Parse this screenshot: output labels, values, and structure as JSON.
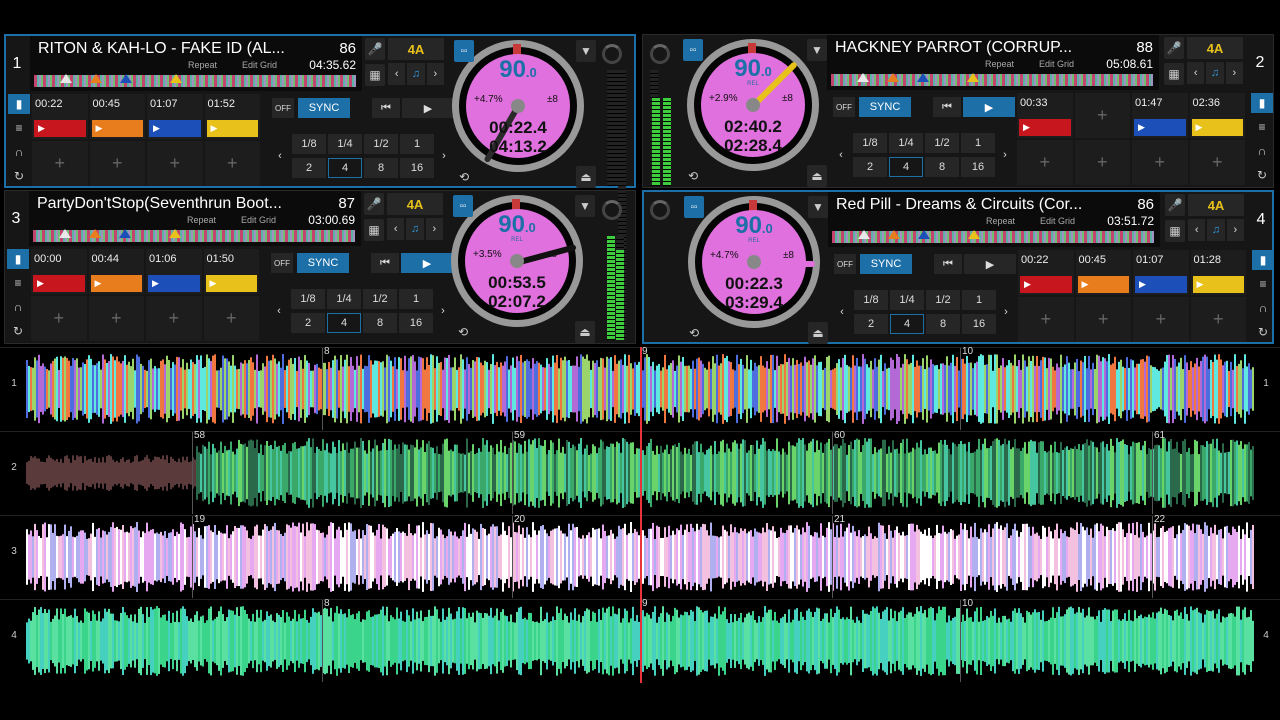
{
  "decks": [
    {
      "num": "1",
      "title": "RITON & KAH-LO - FAKE ID (AL...",
      "bpm": "86",
      "repeat": "Repeat",
      "edit_grid": "Edit Grid",
      "time": "04:35.62",
      "key": "4A",
      "jog": {
        "bpm_main": "90",
        "bpm_dec": ".0",
        "rel": "",
        "pitch": "+4.7%",
        "range": "±8",
        "elapsed": "00:22.4",
        "remaining": "04:13.2",
        "hand_angle": 120,
        "hand_color": "#2a2a2a"
      },
      "sync": "SYNC",
      "off": "OFF",
      "loops_top": [
        "1/8",
        "1/4",
        "1/2",
        "1"
      ],
      "loops_bottom": [
        "2",
        "4",
        "8",
        "16"
      ],
      "cues": [
        {
          "t": "00:22",
          "c": "#c8161e"
        },
        {
          "t": "00:45",
          "c": "#e87d1e"
        },
        {
          "t": "01:07",
          "c": "#1d4fb8"
        },
        {
          "t": "01:52",
          "c": "#e8c21a"
        }
      ]
    },
    {
      "num": "2",
      "title": "HACKNEY PARROT (CORRUP...",
      "bpm": "88",
      "repeat": "Repeat",
      "edit_grid": "Edit Grid",
      "time": "05:08.61",
      "key": "4A",
      "jog": {
        "bpm_main": "90",
        "bpm_dec": ".0",
        "rel": "REL",
        "pitch": "+2.9%",
        "range": "±8",
        "elapsed": "02:40.2",
        "remaining": "02:28.4",
        "hand_angle": -45,
        "hand_color": "#e8c21a"
      },
      "sync": "SYNC",
      "off": "OFF",
      "loops_top": [
        "1/8",
        "1/4",
        "1/2",
        "1"
      ],
      "loops_bottom": [
        "2",
        "4",
        "8",
        "16"
      ],
      "cues": [
        {
          "t": "00:33",
          "c": "#c8161e"
        },
        {
          "t": "",
          "c": ""
        },
        {
          "t": "01:47",
          "c": "#1d4fb8"
        },
        {
          "t": "02:36",
          "c": "#e8c21a"
        }
      ]
    },
    {
      "num": "3",
      "title": "PartyDon'tStop(Seventhrun Boot...",
      "bpm": "87",
      "repeat": "Repeat",
      "edit_grid": "Edit Grid",
      "time": "03:00.69",
      "key": "4A",
      "jog": {
        "bpm_main": "90",
        "bpm_dec": ".0",
        "rel": "REL",
        "pitch": "+3.5%",
        "range": "±8",
        "elapsed": "00:53.5",
        "remaining": "02:07.2",
        "hand_angle": -15,
        "hand_color": "#111"
      },
      "sync": "SYNC",
      "off": "OFF",
      "loops_top": [
        "1/8",
        "1/4",
        "1/2",
        "1"
      ],
      "loops_bottom": [
        "2",
        "4",
        "8",
        "16"
      ],
      "cues": [
        {
          "t": "00:00",
          "c": "#c8161e"
        },
        {
          "t": "00:44",
          "c": "#e87d1e"
        },
        {
          "t": "01:06",
          "c": "#1d4fb8"
        },
        {
          "t": "01:50",
          "c": "#e8c21a"
        }
      ]
    },
    {
      "num": "4",
      "title": "Red Pill - Dreams & Circuits (Cor...",
      "bpm": "86",
      "repeat": "Repeat",
      "edit_grid": "Edit Grid",
      "time": "03:51.72",
      "key": "4A",
      "jog": {
        "bpm_main": "90",
        "bpm_dec": ".0",
        "rel": "REL",
        "pitch": "+4.7%",
        "range": "±8",
        "elapsed": "00:22.3",
        "remaining": "03:29.4",
        "hand_angle": 0,
        "hand_color": "#e070de"
      },
      "sync": "SYNC",
      "off": "OFF",
      "loops_top": [
        "1/8",
        "1/4",
        "1/2",
        "1"
      ],
      "loops_bottom": [
        "2",
        "4",
        "8",
        "16"
      ],
      "cues": [
        {
          "t": "00:22",
          "c": "#c8161e"
        },
        {
          "t": "00:45",
          "c": "#e87d1e"
        },
        {
          "t": "01:07",
          "c": "#1d4fb8"
        },
        {
          "t": "01:28",
          "c": "#e8c21a"
        }
      ]
    }
  ],
  "lanes": [
    {
      "num_left": "1",
      "num_right": "1",
      "beats": [
        "8",
        "9",
        "10"
      ],
      "palette": [
        "#5ee8e0",
        "#9ad46a",
        "#b46ad6",
        "#f07840",
        "#4e6ee0"
      ]
    },
    {
      "num_left": "2",
      "num_right": "",
      "beats": [
        "58",
        "59",
        "60",
        "61"
      ],
      "palette": [
        "#3aa868",
        "#46c6a0",
        "#6ad46a",
        "#2a6a4a"
      ]
    },
    {
      "num_left": "3",
      "num_right": "",
      "beats": [
        "19",
        "20",
        "21",
        "22"
      ],
      "palette": [
        "#e6a8f0",
        "#f4c0e0",
        "#b0b0f0",
        "#ffffff"
      ]
    },
    {
      "num_left": "4",
      "num_right": "4",
      "beats": [
        "8",
        "9",
        "10"
      ],
      "palette": [
        "#3ad48a",
        "#46d0c0",
        "#5ae0a0"
      ]
    }
  ],
  "icons": {
    "mic": "microphone-icon",
    "grid": "grid-icon",
    "sync_link": "link-icon",
    "eject": "eject-icon",
    "cue": "cue-icon",
    "play": "play-icon"
  }
}
